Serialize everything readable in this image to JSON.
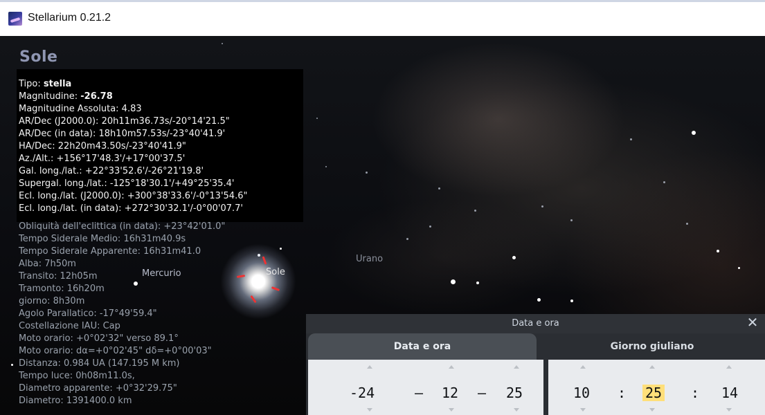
{
  "window": {
    "title": "Stellarium 0.21.2",
    "app_icon": "stellarium-icon"
  },
  "object": {
    "name": "Sole",
    "type_label": "Tipo: ",
    "type_value": "stella",
    "mag_label": "Magnitudine: ",
    "mag_value": "-26.78",
    "lines_black": [
      "Magnitudine Assoluta: 4.83",
      "AR/Dec (J2000.0): 20h11m36.73s/-20°14'21.5\"",
      "AR/Dec (in data): 18h10m57.53s/-23°40'41.9'",
      "HA/Dec: 22h20m43.50s/-23°40'41.9\"",
      "Az./Alt.: +156°17'48.3'/+17°00'37.5'",
      "Gal. long./lat.: +22°33'52.6'/-26°21'19.8'",
      "Supergal. long./lat.: -125°18'30.1'/+49°25'35.4'",
      "Ecl. long./lat. (J2000.0): +300°38'33.6'/-0°13'54.6\"",
      "Ecl. long./lat. (in data): +272°30'32.1'/-0°00'07.7'"
    ],
    "lines_dim": [
      "Obliquità dell'eclittica (in data): +23°42'01.0\"",
      "Tempo Siderale Medio: 16h31m40.9s",
      "Tempo Siderale Apparente: 16h31m41.0",
      "Alba: 7h50m",
      "Transito: 12h05m",
      "Tramonto: 16h20m",
      "giorno: 8h30m",
      "Agolo Parallatico: -17°49'59.4\"",
      "Costellazione IAU: Cap",
      "Moto orario: +0°02'32\" verso 89.1°",
      "Moto orario: dα=+0°02'45\" dδ=+0°00'03\"",
      "Distanza: 0.984 UA (147.195 M km)",
      "Tempo luce: 0h08m11.0s,",
      "Diametro apparente: +0°32'29.75\"",
      "Diametro: 1391400.0 km"
    ]
  },
  "sky_labels": {
    "mercury": "Mercurio",
    "sun": "Sole",
    "uranus": "Urano"
  },
  "datetime_panel": {
    "title": "Data e ora",
    "close_glyph": "✕",
    "tabs": [
      {
        "label": "Data e ora"
      },
      {
        "label": "Giorno giuliano"
      }
    ],
    "date": {
      "year": "-24",
      "sep1": "–",
      "month": "12",
      "sep2": "–",
      "day": "25"
    },
    "time": {
      "hour": "10",
      "sep1": ":",
      "minute": "25",
      "sep2": ":",
      "second": "14"
    }
  },
  "colors": {
    "title_accent": "#8f96b2",
    "highlight": "#ffdf7a",
    "sun_markers": "#e33"
  }
}
